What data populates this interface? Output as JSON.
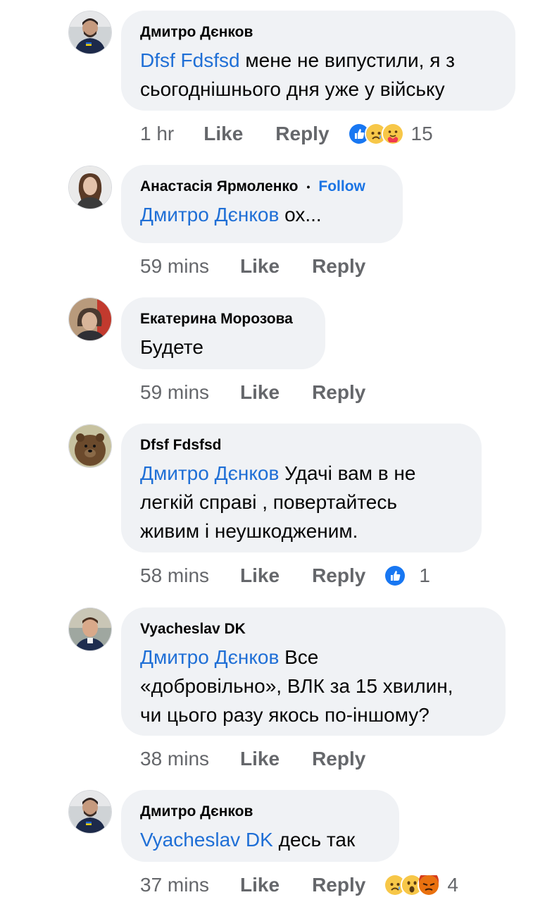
{
  "comments": [
    {
      "author": "Дмитро Дєнков",
      "follow": "",
      "mention": "Dfsf Fdsfsd",
      "text_lines": [
        " мене не випустили, я з",
        "сьогоднішнього дня уже у війську"
      ],
      "time": "1 hr",
      "like": "Like",
      "reply": "Reply",
      "reactions": [
        "like-reaction-icon",
        "sad-reaction-icon",
        "care-reaction-icon"
      ],
      "reaction_count": "15"
    },
    {
      "author": "Анастасія Ярмоленко",
      "follow": "Follow",
      "mention": "Дмитро Дєнков",
      "text_lines": [
        " ох..."
      ],
      "time": "59 mins",
      "like": "Like",
      "reply": "Reply",
      "reactions": [],
      "reaction_count": ""
    },
    {
      "author": "Екатерина Морозова",
      "follow": "",
      "mention": "",
      "text_lines": [
        "Будете"
      ],
      "time": "59 mins",
      "like": "Like",
      "reply": "Reply",
      "reactions": [],
      "reaction_count": ""
    },
    {
      "author": "Dfsf Fdsfsd",
      "follow": "",
      "mention": "Дмитро Дєнков",
      "text_lines": [
        " Удачі вам в не",
        "легкій справі , повертайтесь",
        "живим і неушкодженим."
      ],
      "time": "58 mins",
      "like": "Like",
      "reply": "Reply",
      "reactions": [
        "like-reaction-icon"
      ],
      "reaction_count": "1"
    },
    {
      "author": "Vyacheslav DK",
      "follow": "",
      "mention": "Дмитро Дєнков",
      "text_lines": [
        " Все",
        "«добровільно», ВЛК за 15 хвилин,",
        "чи цього разу якось по-іншому?"
      ],
      "time": "38 mins",
      "like": "Like",
      "reply": "Reply",
      "reactions": [],
      "reaction_count": ""
    },
    {
      "author": "Дмитро Дєнков",
      "follow": "",
      "mention": "Vyacheslav DK",
      "text_lines": [
        " десь так"
      ],
      "time": "37 mins",
      "like": "Like",
      "reply": "Reply",
      "reactions": [
        "sad-reaction-icon",
        "wow-reaction-icon",
        "angry-reaction-icon"
      ],
      "reaction_count": "4"
    }
  ],
  "colors": {
    "bubble": "#f0f2f5",
    "mention": "#1f6fd6",
    "meta": "#65676b",
    "follow": "#1b74e4"
  }
}
